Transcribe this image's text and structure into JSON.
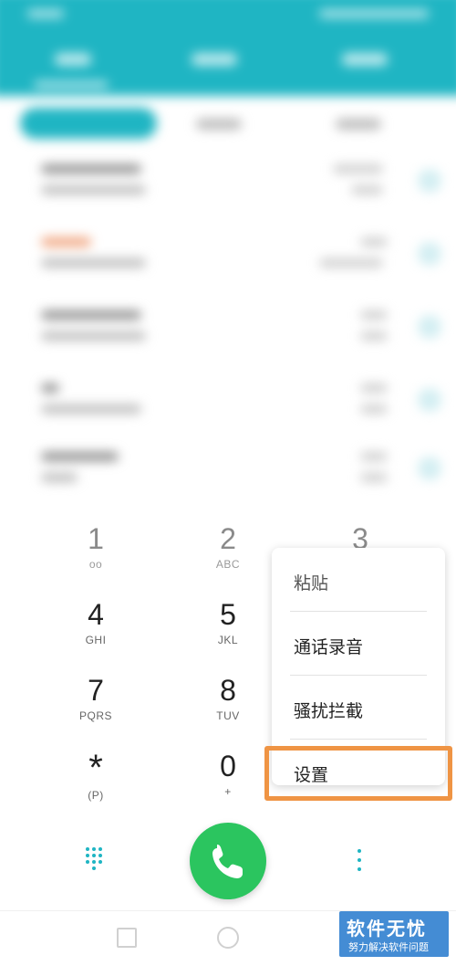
{
  "keypad": [
    {
      "num": "1",
      "sub": "oo"
    },
    {
      "num": "2",
      "sub": "ABC"
    },
    {
      "num": "3",
      "sub": ""
    },
    {
      "num": "4",
      "sub": "GHI"
    },
    {
      "num": "5",
      "sub": "JKL"
    },
    {
      "num": "7",
      "sub": "PQRS"
    },
    {
      "num": "8",
      "sub": "TUV"
    },
    {
      "num": "*",
      "sub": "(P)"
    },
    {
      "num": "0",
      "sub": "+"
    }
  ],
  "menu": {
    "items": [
      "粘贴",
      "通话录音",
      "骚扰拦截",
      "设置"
    ],
    "highlighted_item": "设置"
  },
  "colors": {
    "accent": "#1fb5c3",
    "call_button": "#2bc55f",
    "highlight_border": "#ef9444"
  },
  "icons": {
    "dialpad": "dialpad-icon",
    "call": "phone-icon",
    "more": "more-vertical-icon"
  },
  "watermark": {
    "title": "软件无忧",
    "subtitle": "努力解决软件问题"
  }
}
